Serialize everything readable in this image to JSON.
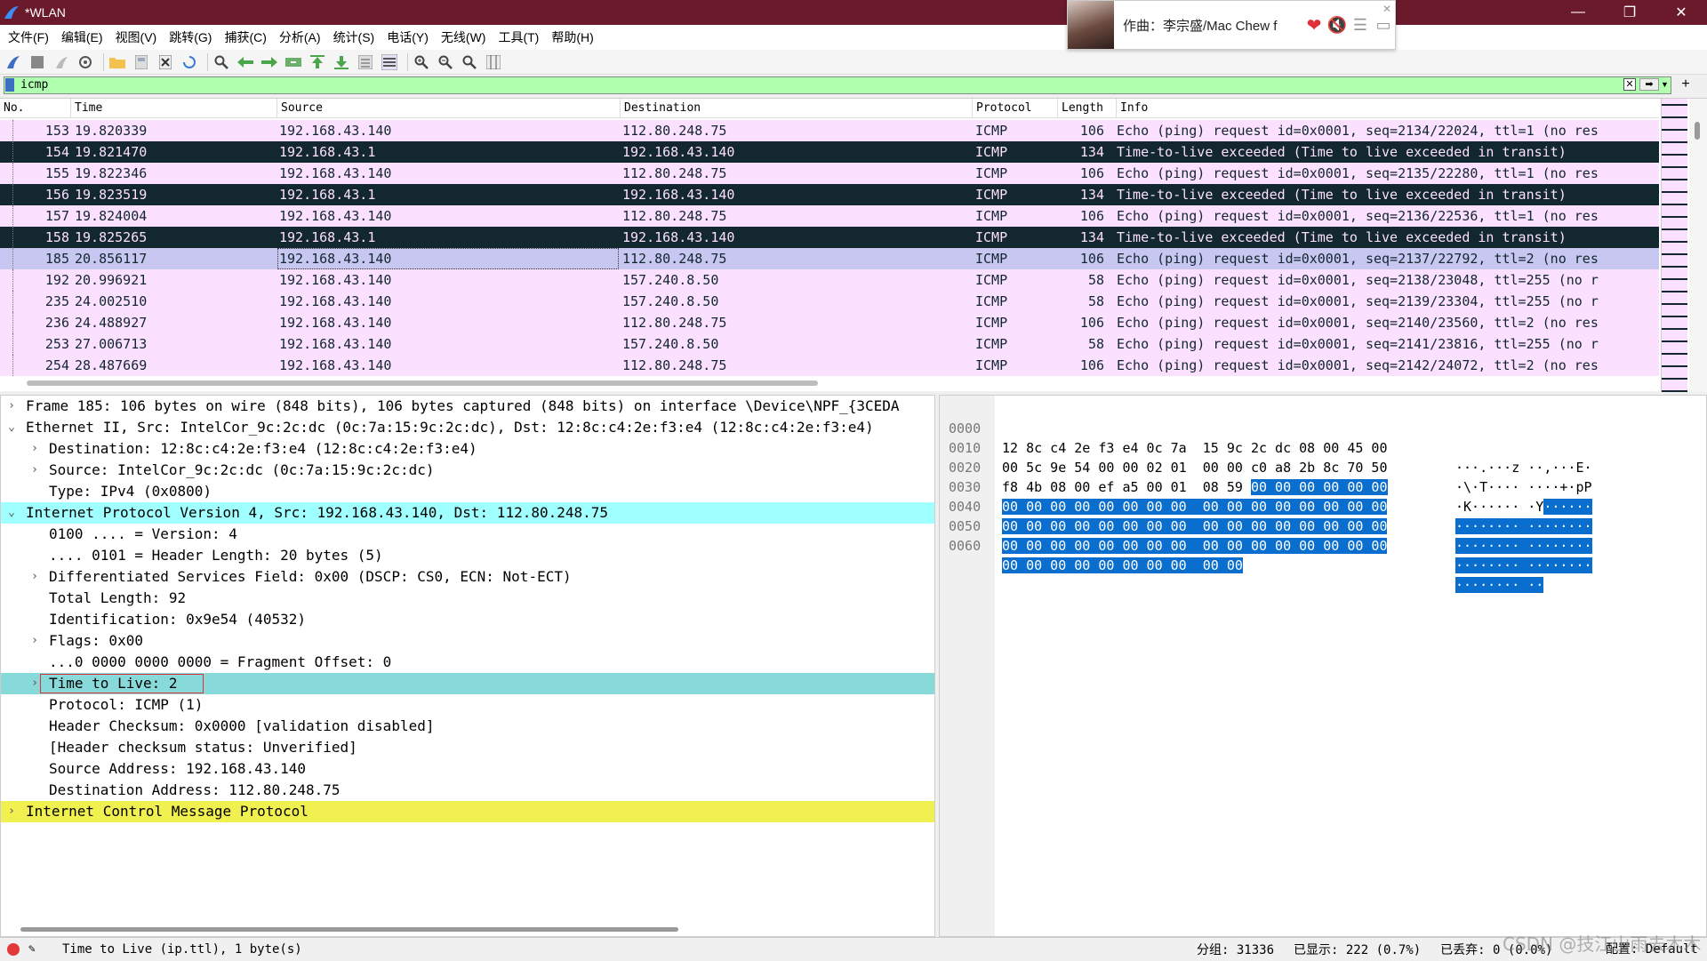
{
  "window": {
    "title": "*WLAN",
    "minimize": "—",
    "maximize": "❐",
    "close": "✕"
  },
  "music_popup": {
    "song": "作曲：李宗盛/Mac Chew f"
  },
  "menu": [
    "文件(F)",
    "编辑(E)",
    "视图(V)",
    "跳转(G)",
    "捕获(C)",
    "分析(A)",
    "统计(S)",
    "电话(Y)",
    "无线(W)",
    "工具(T)",
    "帮助(H)"
  ],
  "filter": {
    "value": "icmp",
    "clear": "✕",
    "apply": "➡",
    "add": "+"
  },
  "packet_list": {
    "columns": [
      "No.",
      "Time",
      "Source",
      "Destination",
      "Protocol",
      "Length",
      "Info"
    ],
    "rows": [
      {
        "no": "153",
        "time": "19.820339",
        "src": "192.168.43.140",
        "dst": "112.80.248.75",
        "proto": "ICMP",
        "len": "106",
        "info": "Echo (ping) request  id=0x0001, seq=2134/22024, ttl=1 (no res"
      },
      {
        "no": "154",
        "time": "19.821470",
        "src": "192.168.43.1",
        "dst": "192.168.43.140",
        "proto": "ICMP",
        "len": "134",
        "info": "Time-to-live exceeded (Time to live exceeded in transit)"
      },
      {
        "no": "155",
        "time": "19.822346",
        "src": "192.168.43.140",
        "dst": "112.80.248.75",
        "proto": "ICMP",
        "len": "106",
        "info": "Echo (ping) request  id=0x0001, seq=2135/22280, ttl=1 (no res"
      },
      {
        "no": "156",
        "time": "19.823519",
        "src": "192.168.43.1",
        "dst": "192.168.43.140",
        "proto": "ICMP",
        "len": "134",
        "info": "Time-to-live exceeded (Time to live exceeded in transit)"
      },
      {
        "no": "157",
        "time": "19.824004",
        "src": "192.168.43.140",
        "dst": "112.80.248.75",
        "proto": "ICMP",
        "len": "106",
        "info": "Echo (ping) request  id=0x0001, seq=2136/22536, ttl=1 (no res"
      },
      {
        "no": "158",
        "time": "19.825265",
        "src": "192.168.43.1",
        "dst": "192.168.43.140",
        "proto": "ICMP",
        "len": "134",
        "info": "Time-to-live exceeded (Time to live exceeded in transit)"
      },
      {
        "no": "185",
        "time": "20.856117",
        "src": "192.168.43.140",
        "dst": "112.80.248.75",
        "proto": "ICMP",
        "len": "106",
        "info": "Echo (ping) request  id=0x0001, seq=2137/22792, ttl=2 (no res"
      },
      {
        "no": "192",
        "time": "20.996921",
        "src": "192.168.43.140",
        "dst": "157.240.8.50",
        "proto": "ICMP",
        "len": "58",
        "info": "Echo (ping) request  id=0x0001, seq=2138/23048, ttl=255 (no r"
      },
      {
        "no": "235",
        "time": "24.002510",
        "src": "192.168.43.140",
        "dst": "157.240.8.50",
        "proto": "ICMP",
        "len": "58",
        "info": "Echo (ping) request  id=0x0001, seq=2139/23304, ttl=255 (no r"
      },
      {
        "no": "236",
        "time": "24.488927",
        "src": "192.168.43.140",
        "dst": "112.80.248.75",
        "proto": "ICMP",
        "len": "106",
        "info": "Echo (ping) request  id=0x0001, seq=2140/23560, ttl=2 (no res"
      },
      {
        "no": "253",
        "time": "27.006713",
        "src": "192.168.43.140",
        "dst": "157.240.8.50",
        "proto": "ICMP",
        "len": "58",
        "info": "Echo (ping) request  id=0x0001, seq=2141/23816, ttl=255 (no r"
      },
      {
        "no": "254",
        "time": "28.487669",
        "src": "192.168.43.140",
        "dst": "112.80.248.75",
        "proto": "ICMP",
        "len": "106",
        "info": "Echo (ping) request  id=0x0001, seq=2142/24072, ttl=2 (no res"
      }
    ]
  },
  "details": {
    "rows": [
      {
        "arrow": "›",
        "text": "Frame 185: 106 bytes on wire (848 bits), 106 bytes captured (848 bits) on interface \\Device\\NPF_{3CEDA"
      },
      {
        "arrow": "⌄",
        "text": "Ethernet II, Src: IntelCor_9c:2c:dc (0c:7a:15:9c:2c:dc), Dst: 12:8c:c4:2e:f3:e4 (12:8c:c4:2e:f3:e4)"
      },
      {
        "arrow": "›",
        "text": "Destination: 12:8c:c4:2e:f3:e4 (12:8c:c4:2e:f3:e4)"
      },
      {
        "arrow": "›",
        "text": "Source: IntelCor_9c:2c:dc (0c:7a:15:9c:2c:dc)"
      },
      {
        "arrow": "",
        "text": "Type: IPv4 (0x0800)"
      },
      {
        "arrow": "⌄",
        "text": "Internet Protocol Version 4, Src: 192.168.43.140, Dst: 112.80.248.75"
      },
      {
        "arrow": "",
        "text": "0100 .... = Version: 4"
      },
      {
        "arrow": "",
        "text": ".... 0101 = Header Length: 20 bytes (5)"
      },
      {
        "arrow": "›",
        "text": "Differentiated Services Field: 0x00 (DSCP: CS0, ECN: Not-ECT)"
      },
      {
        "arrow": "",
        "text": "Total Length: 92"
      },
      {
        "arrow": "",
        "text": "Identification: 0x9e54 (40532)"
      },
      {
        "arrow": "›",
        "text": "Flags: 0x00"
      },
      {
        "arrow": "",
        "text": "...0 0000 0000 0000 = Fragment Offset: 0"
      },
      {
        "arrow": "›",
        "text": "Time to Live: 2"
      },
      {
        "arrow": "",
        "text": "Protocol: ICMP (1)"
      },
      {
        "arrow": "",
        "text": "Header Checksum: 0x0000 [validation disabled]"
      },
      {
        "arrow": "",
        "text": "[Header checksum status: Unverified]"
      },
      {
        "arrow": "",
        "text": "Source Address: 192.168.43.140"
      },
      {
        "arrow": "",
        "text": "Destination Address: 112.80.248.75"
      },
      {
        "arrow": "›",
        "text": "Internet Control Message Protocol"
      }
    ]
  },
  "bytes": {
    "rows": [
      {
        "off": "0000",
        "hex_a": "12 8c c4 2e f3 e4 0c 7a  15 9c 2c dc 08 00 45 00",
        "hex_b": "",
        "asc_a": "···.···z ··,···E·",
        "asc_b": ""
      },
      {
        "off": "0010",
        "hex_a": "00 5c 9e 54 00 00 02 01  00 00 c0 a8 2b 8c 70 50",
        "hex_b": "",
        "asc_a": "·\\·T···· ····+·pP",
        "asc_b": ""
      },
      {
        "off": "0020",
        "hex_a": "f8 4b 08 00 ef a5 00 01  08 59 ",
        "hex_b": "00 00 00 00 00 00",
        "asc_a": "·K······ ·Y",
        "asc_b": "······"
      },
      {
        "off": "0030",
        "hex_a": "",
        "hex_b": "00 00 00 00 00 00 00 00  00 00 00 00 00 00 00 00",
        "asc_a": "",
        "asc_b": "········ ········"
      },
      {
        "off": "0040",
        "hex_a": "",
        "hex_b": "00 00 00 00 00 00 00 00  00 00 00 00 00 00 00 00",
        "asc_a": "",
        "asc_b": "········ ········"
      },
      {
        "off": "0050",
        "hex_a": "",
        "hex_b": "00 00 00 00 00 00 00 00  00 00 00 00 00 00 00 00",
        "asc_a": "",
        "asc_b": "········ ········"
      },
      {
        "off": "0060",
        "hex_a": "",
        "hex_b": "00 00 00 00 00 00 00 00  00 00",
        "asc_a": "",
        "asc_b": "········ ··"
      }
    ]
  },
  "status": {
    "field_info": "Time to Live (ip.ttl), 1 byte(s)",
    "packets": "分组: 31336",
    "displayed": "已显示: 222 (0.7%)",
    "dropped": "已丢弃: 0 (0.0%)",
    "profile": "配置: Default"
  },
  "watermark": "CSDN @技江山雨去木木"
}
